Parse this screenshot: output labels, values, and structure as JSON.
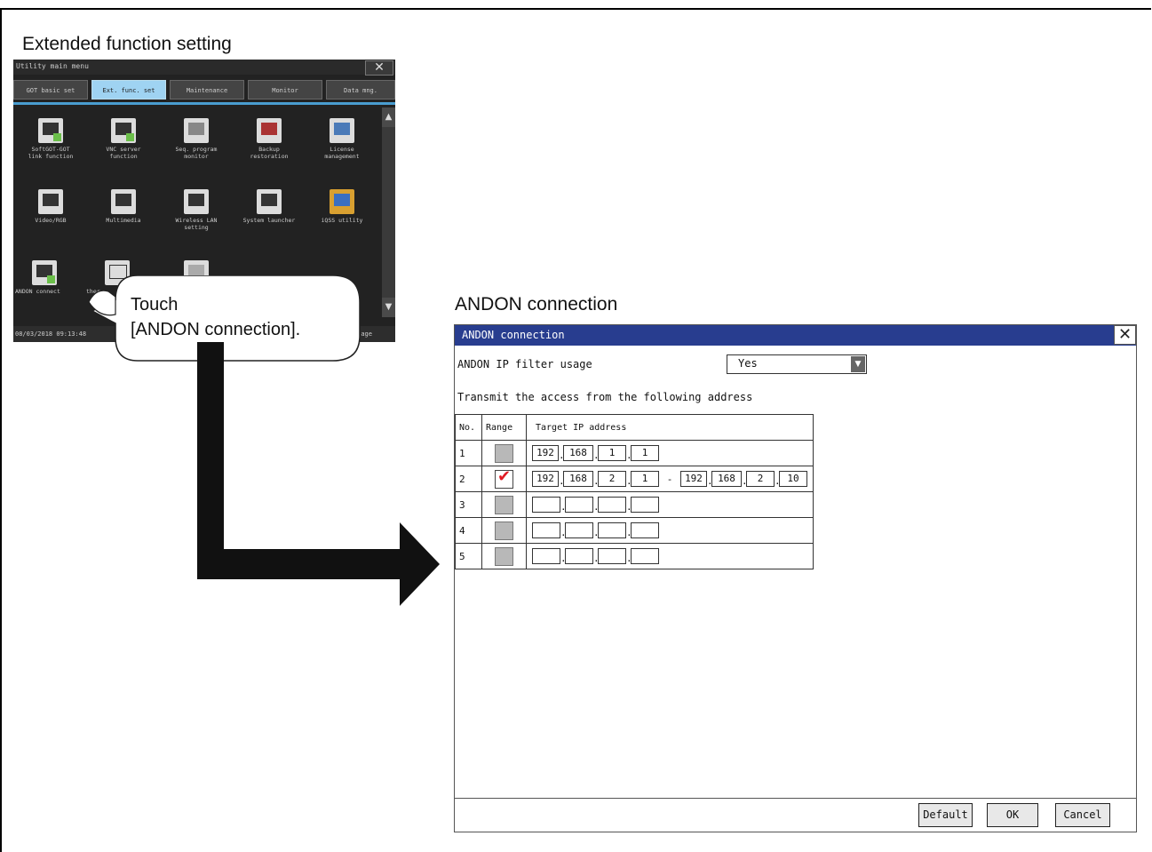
{
  "captions": {
    "left": "Extended function setting",
    "right": "ANDON connection"
  },
  "utility_menu": {
    "title": "Utility main menu",
    "tabs": [
      {
        "label": "GOT basic set"
      },
      {
        "label": "Ext. func. set"
      },
      {
        "label": "Maintenance"
      },
      {
        "label": "Monitor"
      },
      {
        "label": "Data mng."
      }
    ],
    "items": [
      {
        "label": "SoftGOT-GOT\nlink function",
        "icon": "network-screen-icon"
      },
      {
        "label": "VNC server\nfunction",
        "icon": "vnc-screen-icon"
      },
      {
        "label": "Seq. program\nmonitor",
        "icon": "ladder-monitor-icon"
      },
      {
        "label": "Backup\nrestoration",
        "icon": "backup-icon"
      },
      {
        "label": "License\nmanagement",
        "icon": "license-icon"
      },
      {
        "label": "Video/RGB",
        "icon": "video-icon"
      },
      {
        "label": "Multimedia",
        "icon": "multimedia-icon"
      },
      {
        "label": "Wireless LAN\nsetting",
        "icon": "wireless-icon"
      },
      {
        "label": "System launcher",
        "icon": "system-launcher-icon"
      },
      {
        "label": "iQSS utility",
        "icon": "iqss-icon"
      },
      {
        "label": "ANDON connect",
        "icon": "andon-icon"
      },
      {
        "label": "ther",
        "icon": "printer-icon"
      },
      {
        "label": "",
        "icon": "drive-icon"
      }
    ],
    "status_time": "08/03/2018 09:13:48",
    "status_page": "age"
  },
  "callout": {
    "line1": "Touch",
    "line2": "[ANDON connection]."
  },
  "andon": {
    "title": "ANDON connection",
    "filter_label": "ANDON IP filter usage",
    "filter_value": "Yes",
    "transmit_text": "Transmit the access from the following address",
    "headers": {
      "no": "No.",
      "range": "Range",
      "target": "Target IP address"
    },
    "rows": [
      {
        "no": "1",
        "range": false,
        "from": [
          "192",
          "168",
          "1",
          "1"
        ],
        "to": null
      },
      {
        "no": "2",
        "range": true,
        "from": [
          "192",
          "168",
          "2",
          "1"
        ],
        "to": [
          "192",
          "168",
          "2",
          "10"
        ]
      },
      {
        "no": "3",
        "range": false,
        "from": [
          "",
          "",
          "",
          ""
        ],
        "to": null
      },
      {
        "no": "4",
        "range": false,
        "from": [
          "",
          "",
          "",
          ""
        ],
        "to": null
      },
      {
        "no": "5",
        "range": false,
        "from": [
          "",
          "",
          "",
          ""
        ],
        "to": null
      }
    ],
    "buttons": {
      "default": "Default",
      "ok": "OK",
      "cancel": "Cancel"
    }
  }
}
